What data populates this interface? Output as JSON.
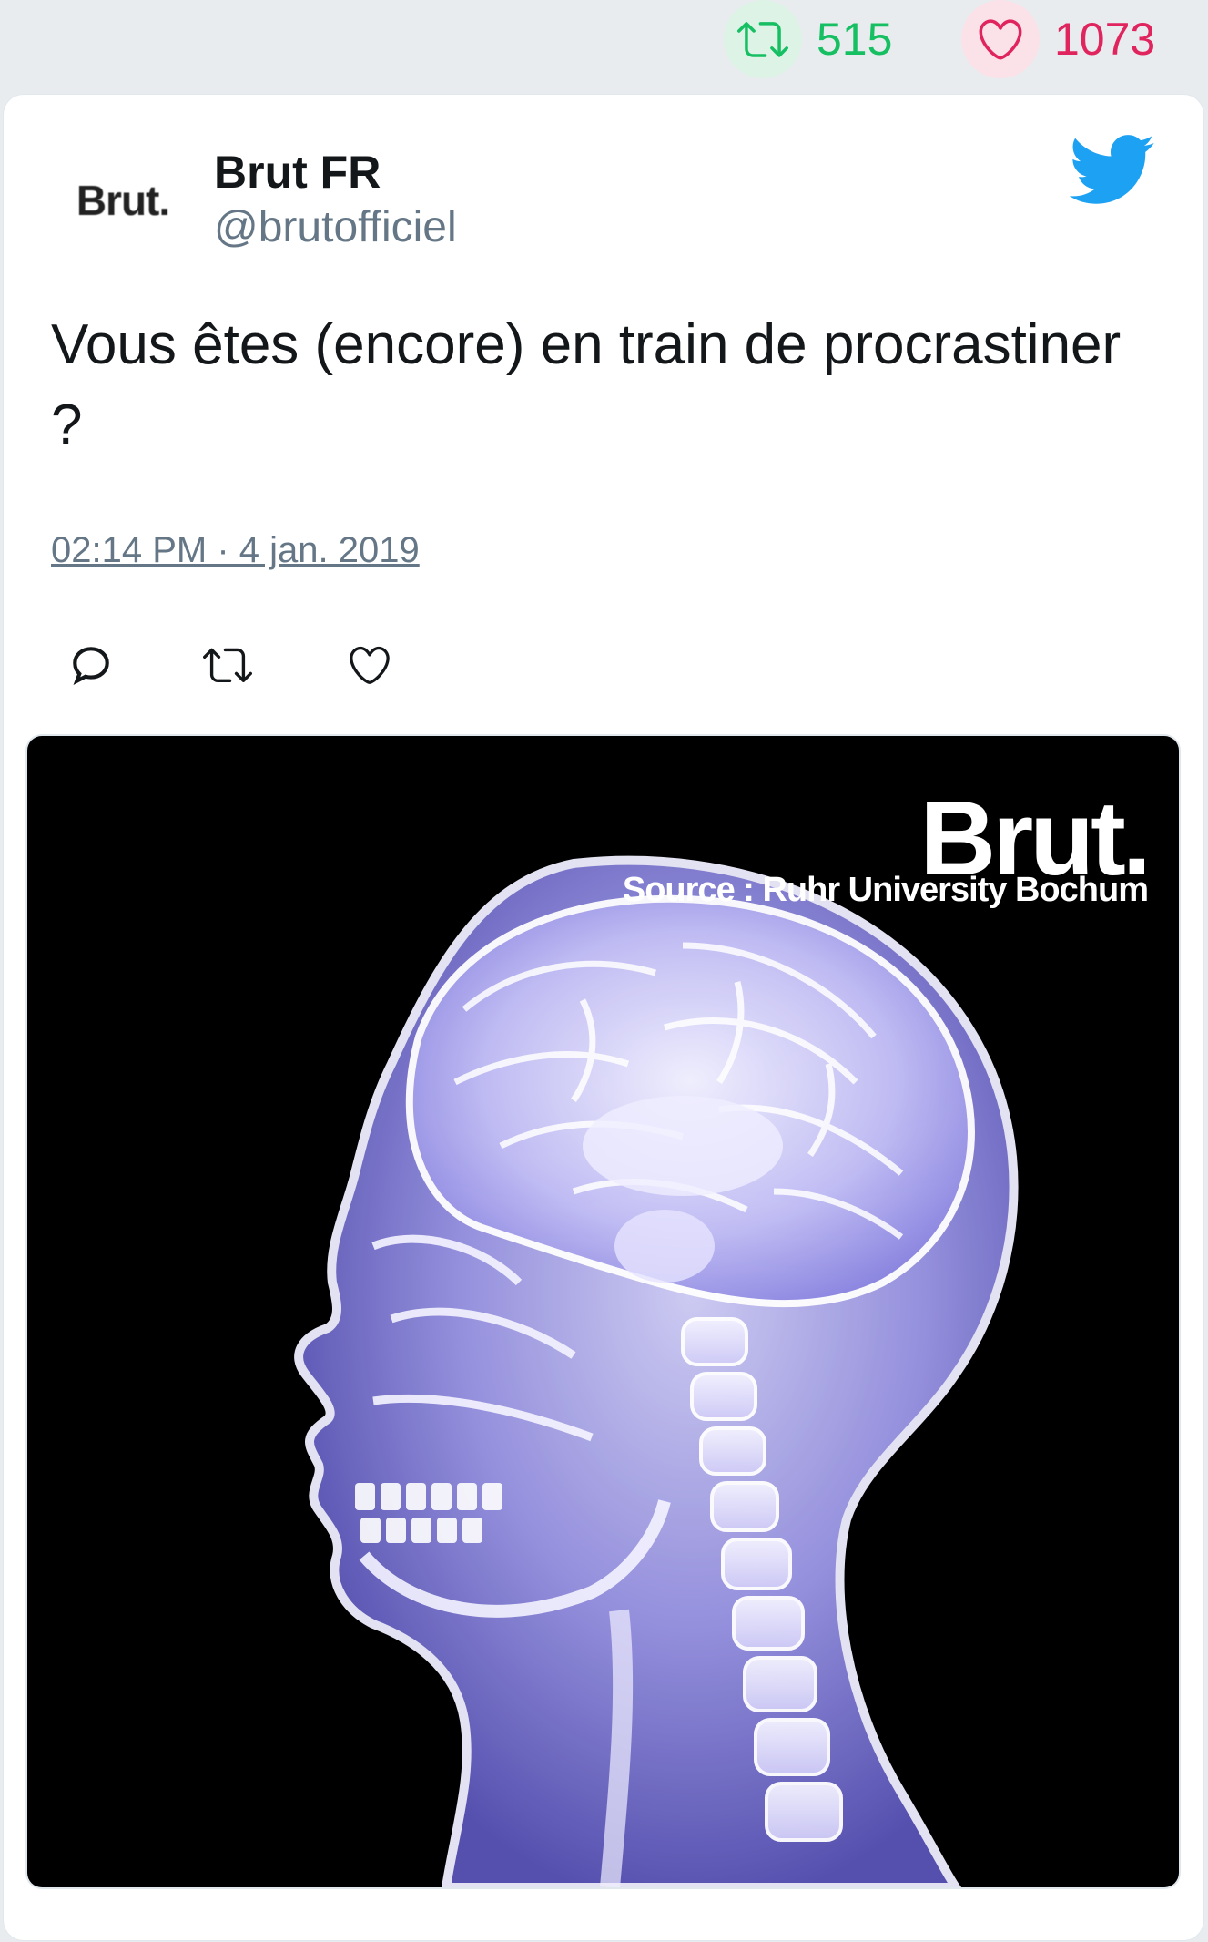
{
  "top_stats": {
    "retweets": "515",
    "likes": "1073",
    "retweet_color": "#17bf63",
    "like_color": "#e0245e",
    "retweet_icon": "retweet-icon",
    "like_icon": "heart-icon"
  },
  "tweet": {
    "avatar_text": "Brut.",
    "author_name": "Brut FR",
    "handle": "@brutofficiel",
    "platform_icon": "twitter-bird-icon",
    "text": "Vous êtes (encore) en train de procrastiner ?",
    "timestamp": "02:14 PM · 4 jan. 2019",
    "actions": [
      "reply-icon",
      "retweet-icon",
      "heart-icon"
    ],
    "accent_color": "#1da1f2"
  },
  "media": {
    "watermark_brand": "Brut.",
    "watermark_source": "Source : Ruhr University Bochum",
    "description_icon": "xray-head-image"
  }
}
